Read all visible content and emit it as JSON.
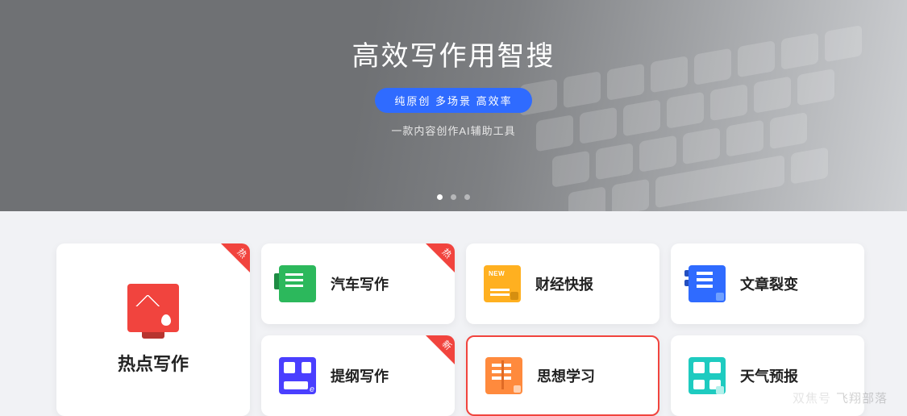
{
  "hero": {
    "title": "高效写作用智搜",
    "pill": "纯原创 多场景 高效率",
    "subtitle": "一款内容创作AI辅助工具"
  },
  "badges": {
    "hot": "热",
    "new": "新"
  },
  "cards": {
    "hot_writing": "热点写作",
    "car": "汽车写作",
    "finance": "财经快报",
    "split": "文章裂变",
    "outline": "提纲写作",
    "thought": "思想学习",
    "weather": "天气预报"
  },
  "watermark": {
    "label": "双焦号",
    "name": "飞翔部落"
  }
}
